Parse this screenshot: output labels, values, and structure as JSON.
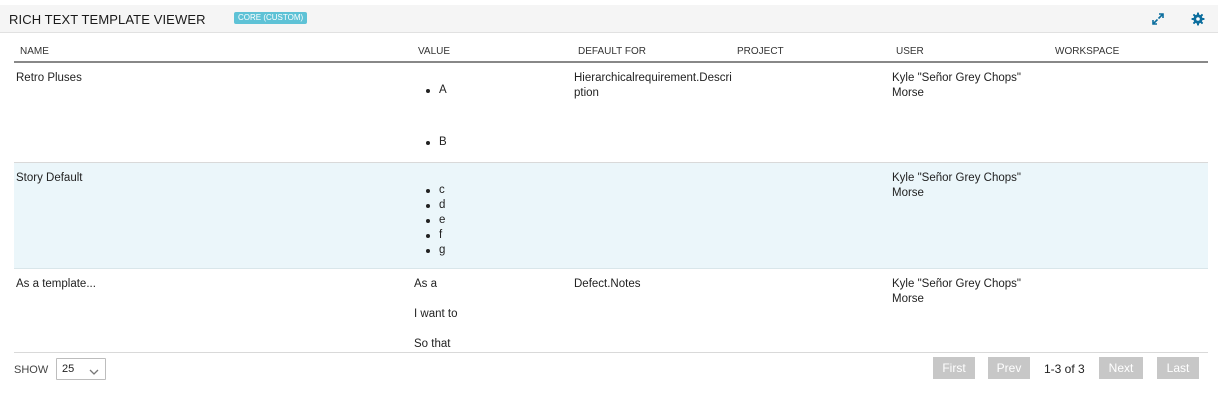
{
  "header": {
    "title": "RICH TEXT TEMPLATE VIEWER",
    "badge": "CORE (CUSTOM)",
    "icons": [
      "expand-icon",
      "gear-icon"
    ],
    "accent_color": "#0c6e9e",
    "badge_color": "#5ec2d6"
  },
  "columns": [
    "NAME",
    "VALUE",
    "DEFAULT FOR",
    "PROJECT",
    "USER",
    "WORKSPACE"
  ],
  "rows": [
    {
      "name": "Retro Pluses",
      "value_bullets": [
        "A",
        "B"
      ],
      "default_for": "Hierarchicalrequirement.Description",
      "project": "",
      "user": "Kyle \"Señor Grey Chops\" Morse",
      "workspace": ""
    },
    {
      "name": "Story Default",
      "value_bullets": [
        "c",
        "d",
        "e",
        "f",
        "g"
      ],
      "default_for": "",
      "project": "",
      "user": "Kyle \"Señor Grey Chops\" Morse",
      "workspace": "",
      "highlighted": true,
      "highlight_color": "#ebf6fa"
    },
    {
      "name": "As a template...",
      "value_lines": [
        "As a",
        "I want to",
        "So that"
      ],
      "default_for": "Defect.Notes",
      "project": "",
      "user": "Kyle \"Señor Grey Chops\" Morse",
      "workspace": ""
    }
  ],
  "footer": {
    "show_label": "SHOW",
    "page_size": "25",
    "first": "First",
    "prev": "Prev",
    "page_info": "1-3 of 3",
    "next": "Next",
    "last": "Last"
  }
}
